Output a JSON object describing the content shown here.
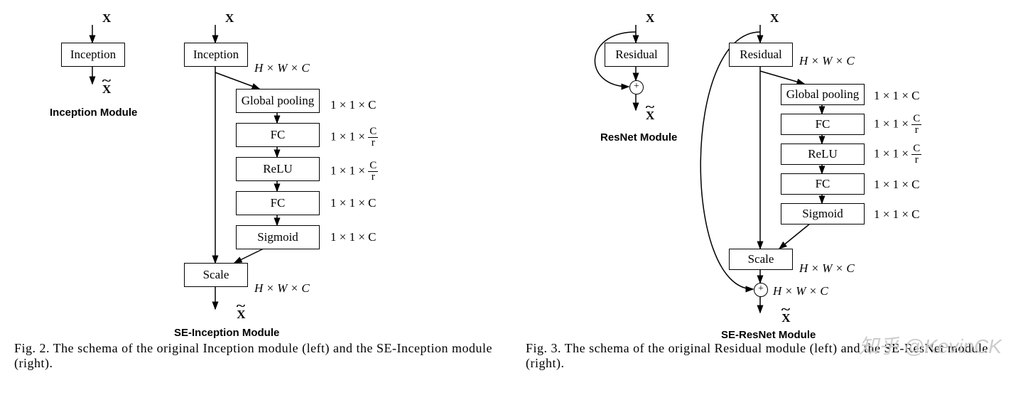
{
  "fig2": {
    "caption": "Fig. 2. The schema of the original Inception module (left) and the SE-Inception module (right).",
    "left": {
      "input": "X",
      "block": "Inception",
      "output": "X",
      "title": "Inception Module"
    },
    "right": {
      "input": "X",
      "blocks": [
        "Inception",
        "Global pooling",
        "FC",
        "ReLU",
        "FC",
        "Sigmoid",
        "Scale"
      ],
      "dims": [
        "H × W × C",
        "1 × 1 × C",
        "",
        "",
        "1 × 1 × C",
        "1 × 1 × C",
        "H × W × C"
      ],
      "dim_fc1": {
        "pre": "1 × 1 × ",
        "num": "C",
        "den": "r"
      },
      "dim_relu": {
        "pre": "1 × 1 × ",
        "num": "C",
        "den": "r"
      },
      "output": "X",
      "title": "SE-Inception Module"
    }
  },
  "fig3": {
    "caption": "Fig. 3. The schema of the original Residual module (left) and the SE-ResNet module (right).",
    "left": {
      "input": "X",
      "block": "Residual",
      "output": "X",
      "title": "ResNet Module"
    },
    "right": {
      "input": "X",
      "blocks": [
        "Residual",
        "Global pooling",
        "FC",
        "ReLU",
        "FC",
        "Sigmoid",
        "Scale"
      ],
      "dims": [
        "H × W × C",
        "1 × 1 × C",
        "",
        "",
        "1 × 1 × C",
        "1 × 1 × C",
        "H × W × C"
      ],
      "dim_fc1": {
        "pre": "1 × 1 × ",
        "num": "C",
        "den": "r"
      },
      "dim_relu": {
        "pre": "1 × 1 × ",
        "num": "C",
        "den": "r"
      },
      "output": "X",
      "plus_dim": "H × W × C",
      "title": "SE-ResNet Module"
    }
  },
  "watermark": "知乎 @KevinCK"
}
